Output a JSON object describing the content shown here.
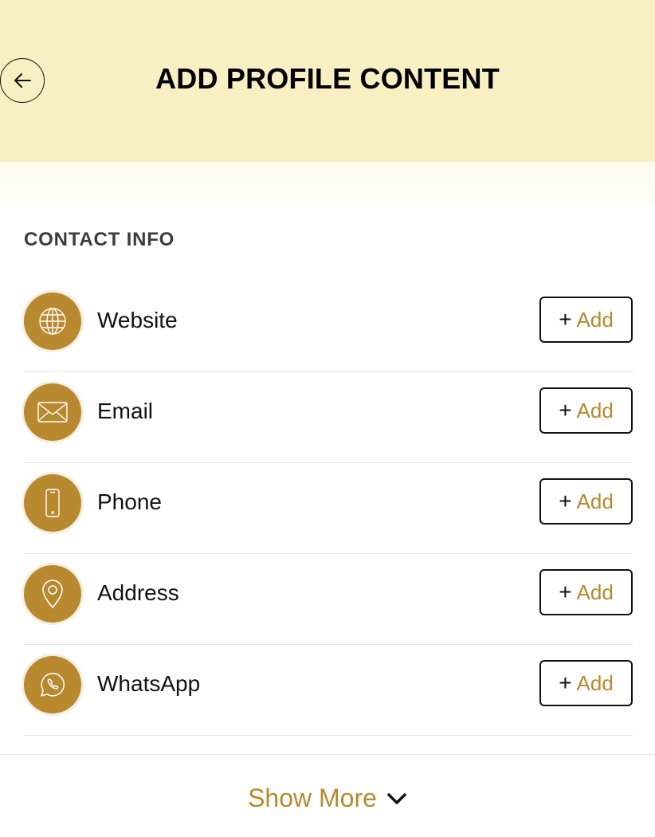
{
  "header": {
    "title": "ADD PROFILE CONTENT",
    "back_icon": "arrow-left-icon",
    "background": "#f8efc3"
  },
  "section": {
    "title": "CONTACT INFO",
    "items": [
      {
        "label": "Website",
        "icon": "globe-icon",
        "action_plus": "+",
        "action_label": "Add"
      },
      {
        "label": "Email",
        "icon": "envelope-icon",
        "action_plus": "+",
        "action_label": "Add"
      },
      {
        "label": "Phone",
        "icon": "mobile-phone-icon",
        "action_plus": "+",
        "action_label": "Add"
      },
      {
        "label": "Address",
        "icon": "map-pin-icon",
        "action_plus": "+",
        "action_label": "Add"
      },
      {
        "label": "WhatsApp",
        "icon": "whatsapp-icon",
        "action_plus": "+",
        "action_label": "Add"
      }
    ]
  },
  "footer": {
    "show_more_label": "Show More",
    "icon": "chevron-down-icon"
  },
  "colors": {
    "accent": "#b8892e",
    "text": "#111111"
  }
}
